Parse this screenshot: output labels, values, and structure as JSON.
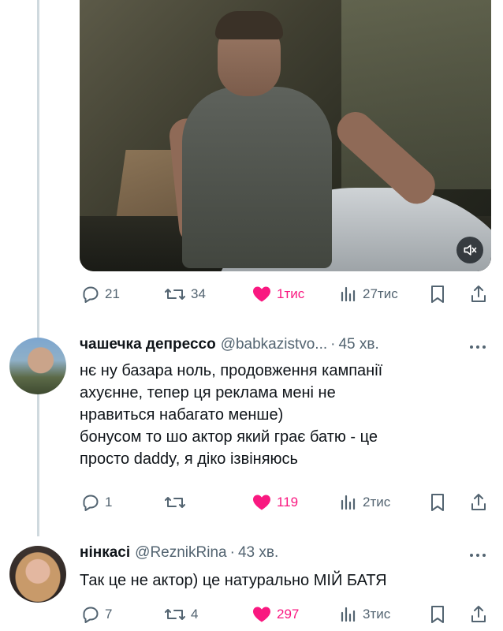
{
  "post": {
    "video_mute_icon": "speaker-muted-icon",
    "actions": {
      "replies": "21",
      "reposts": "34",
      "likes": "1тис",
      "views": "27тис"
    },
    "colors": {
      "like": "#f91880",
      "muted_text": "#536471"
    }
  },
  "replies": [
    {
      "name": "чашечка депрессо",
      "handle": "@babkazistvo...",
      "separator": "·",
      "time": "45 хв.",
      "lines": [
        "нє ну базара ноль, продовження кампанії",
        "ахуєнне, тепер ця реклама мені не",
        "нравиться набагато менше)",
        "бонусом то шо актор який грає батю - це",
        "просто daddy, я діко ізвіняюсь"
      ],
      "actions": {
        "replies": "1",
        "reposts": "",
        "likes": "119",
        "views": "2тис"
      }
    },
    {
      "name": "нінкасі",
      "handle": "@ReznikRina",
      "separator": "·",
      "time": "43 хв.",
      "lines": [
        "Так це не актор) це натурально МІЙ БАТЯ"
      ],
      "actions": {
        "replies": "7",
        "reposts": "4",
        "likes": "297",
        "views": "3тис"
      }
    }
  ]
}
